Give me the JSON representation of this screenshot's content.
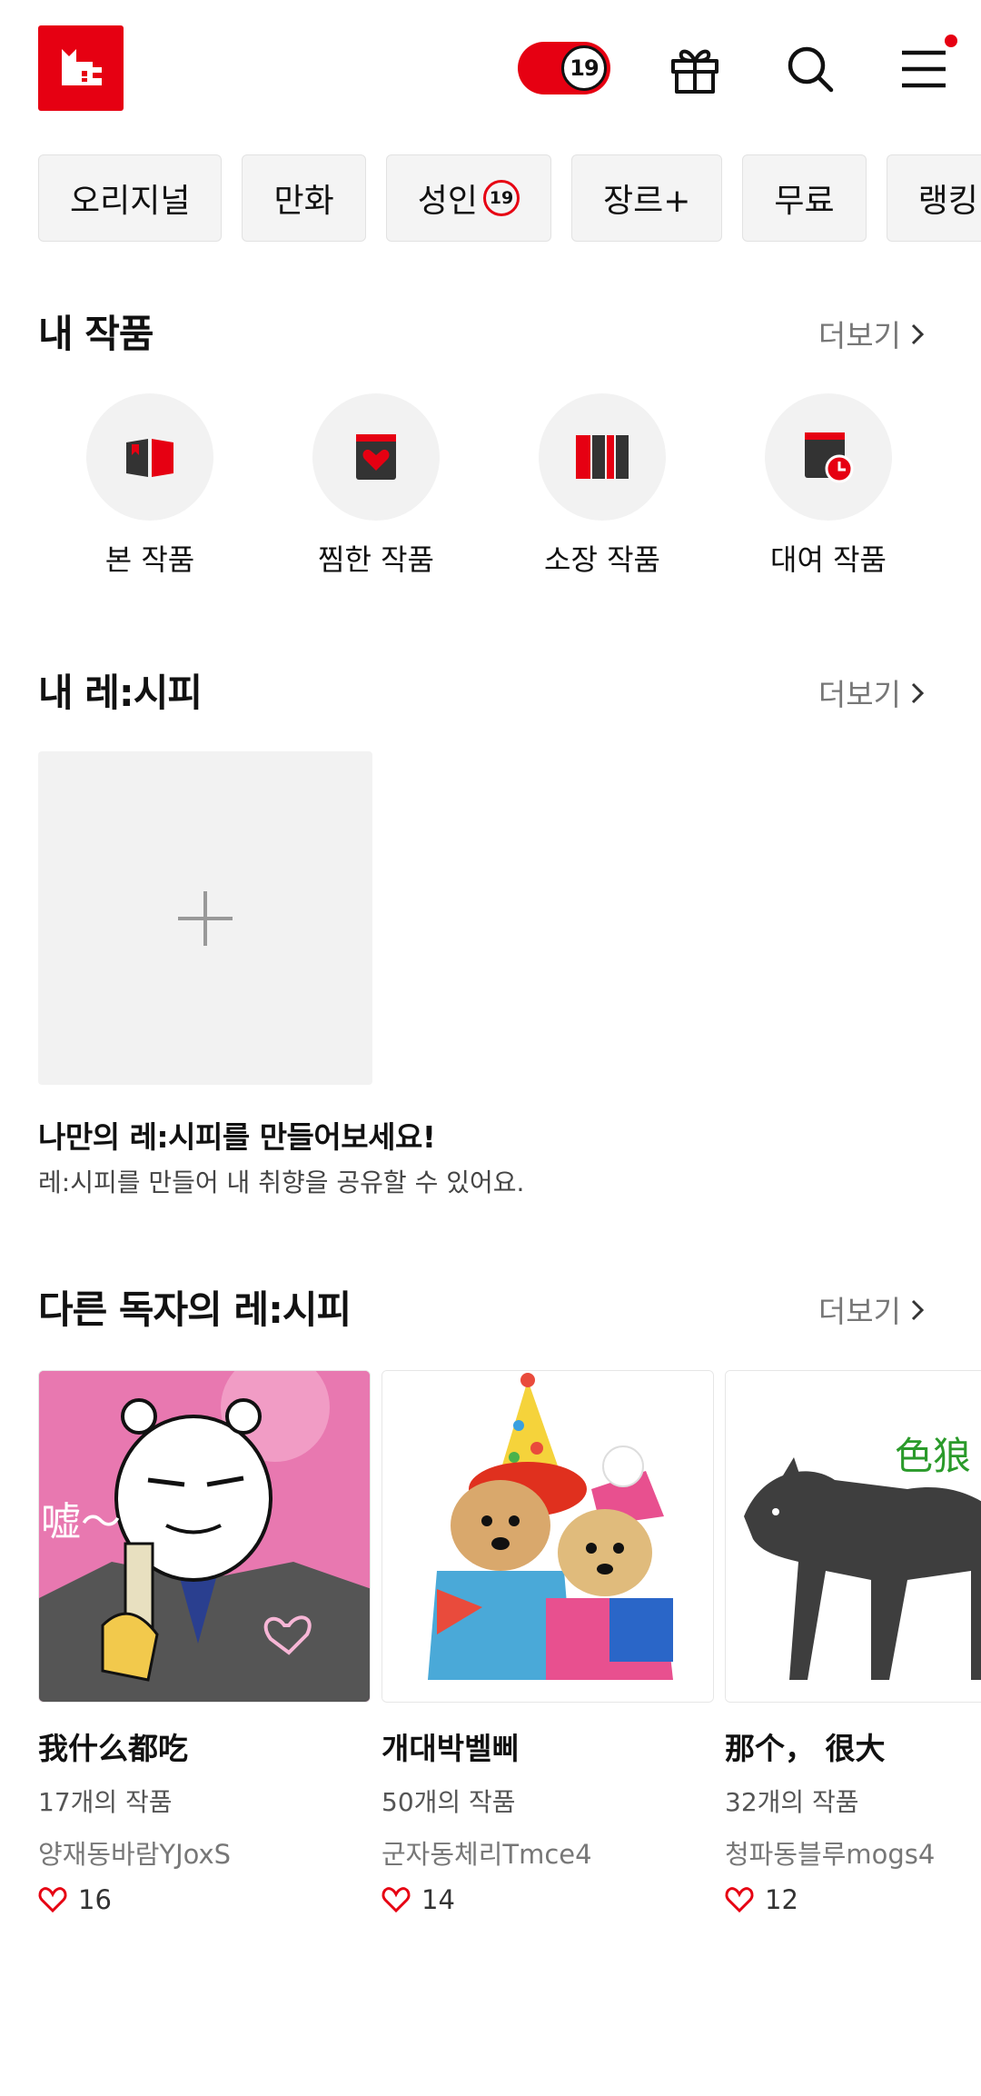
{
  "header": {
    "adult_toggle_label": "19",
    "icons": [
      "logo-icon",
      "gift-icon",
      "search-icon",
      "menu-icon"
    ],
    "accent_color": "#e60012"
  },
  "tabs": [
    {
      "label": "오리지널"
    },
    {
      "label": "만화"
    },
    {
      "label": "성인",
      "badge": "19"
    },
    {
      "label": "장르+"
    },
    {
      "label": "무료"
    },
    {
      "label": "랭킹"
    }
  ],
  "my_works": {
    "title": "내 작품",
    "more": "더보기",
    "items": [
      {
        "label": "본 작품",
        "icon": "open-book-icon"
      },
      {
        "label": "찜한 작품",
        "icon": "heart-book-icon"
      },
      {
        "label": "소장 작품",
        "icon": "bookshelf-icon"
      },
      {
        "label": "대여 작품",
        "icon": "clock-book-icon"
      }
    ]
  },
  "my_recipe": {
    "title": "내 레:시피",
    "more": "더보기",
    "create_title": "나만의 레:시피를 만들어보세요!",
    "create_sub": "레:시피를 만들어 내 취향을 공유할 수 있어요."
  },
  "other_recipe": {
    "title": "다른 독자의 레:시피",
    "more": "더보기",
    "cards": [
      {
        "name": "我什么都吃",
        "count": "17개의 작품",
        "user": "양재동바람YJoxS",
        "likes": "16",
        "thumb_text": "嘘～",
        "thumb_bg": "#e46fa8"
      },
      {
        "name": "개대박벨삐",
        "count": "50개의 작품",
        "user": "군자동체리Tmce4",
        "likes": "14",
        "thumb_bg": "#ffffff"
      },
      {
        "name": "那个， 很大",
        "count": "32개의 작품",
        "user": "청파동블루mogs4",
        "likes": "12",
        "thumb_text": "色狼",
        "thumb_bg": "#ffffff"
      }
    ]
  }
}
